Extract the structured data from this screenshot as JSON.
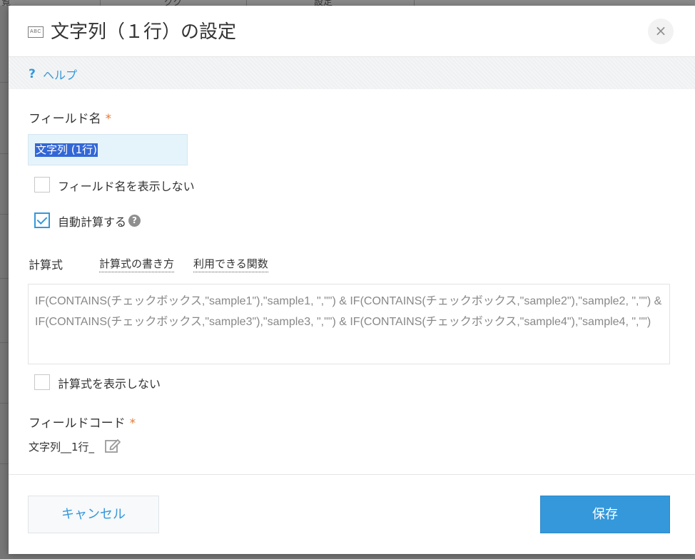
{
  "background": {
    "column_texts": [
      "覧",
      "ググ",
      "設定"
    ]
  },
  "dialog": {
    "title": "文字列（１行）の設定",
    "title_icon_text": "ABC",
    "close_symbol": "×",
    "help": {
      "icon": "?",
      "label": "ヘルプ"
    },
    "field_name": {
      "label": "フィールド名",
      "required_mark": "*",
      "value": "文字列 (1行)"
    },
    "hide_field_name": {
      "label": "フィールド名を表示しない",
      "checked": false
    },
    "auto_calc": {
      "label": "自動計算する",
      "checked": true,
      "help_icon": "?"
    },
    "formula": {
      "label": "計算式",
      "howto_link": "計算式の書き方",
      "functions_link": "利用できる関数",
      "value": "IF(CONTAINS(チェックボックス,\"sample1\"),\"sample1, \",\"\") & IF(CONTAINS(チェックボックス,\"sample2\"),\"sample2, \",\"\") & IF(CONTAINS(チェックボックス,\"sample3\"),\"sample3, \",\"\") & IF(CONTAINS(チェックボックス,\"sample4\"),\"sample4, \",\"\")"
    },
    "hide_formula": {
      "label": "計算式を表示しない",
      "checked": false
    },
    "field_code": {
      "label": "フィールドコード",
      "required_mark": "*",
      "value": "文字列__1行_"
    },
    "footer": {
      "cancel_label": "キャンセル",
      "save_label": "保存"
    },
    "colors": {
      "accent": "#3498db",
      "required": "#e07b39",
      "input_bg": "#e5f4fb",
      "selection": "#3367d6"
    }
  }
}
